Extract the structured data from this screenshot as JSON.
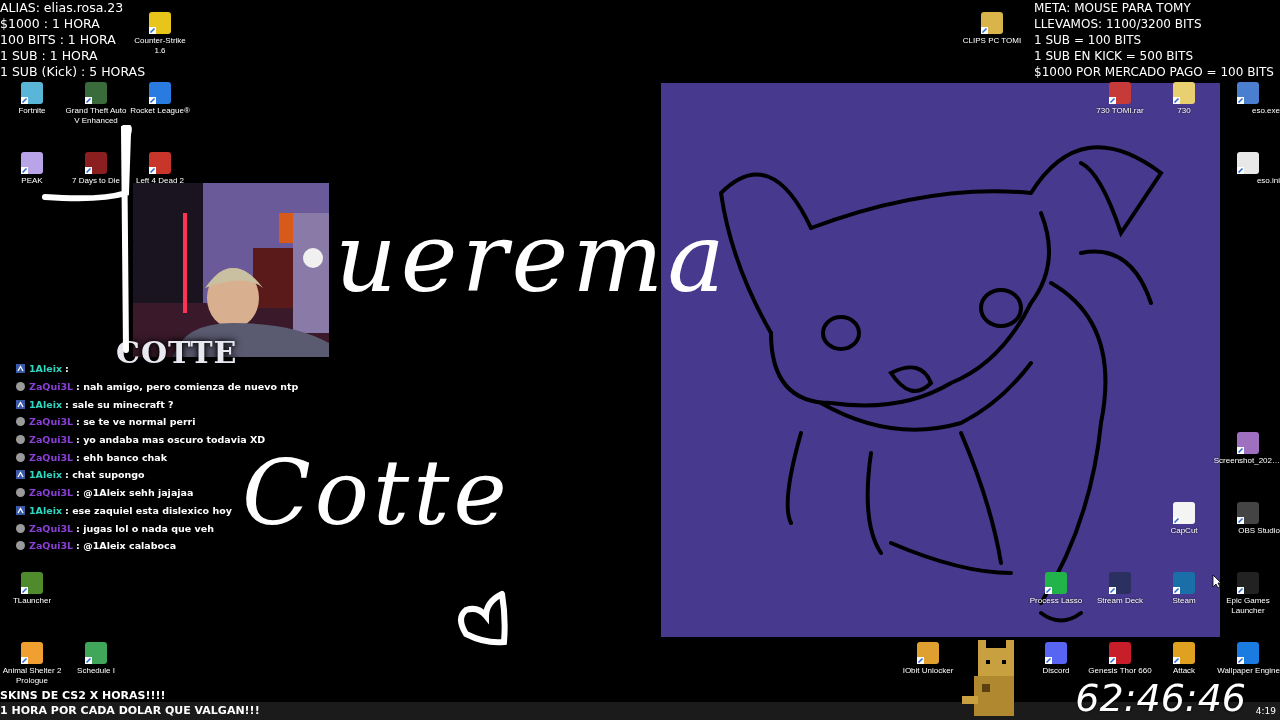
{
  "overlay_left": {
    "lines": [
      "ALIAS: elias.rosa.23",
      "$1000 : 1 HORA",
      "100 BITS : 1 HORA",
      "1 SUB : 1 HORA",
      "1 SUB (Kick) : 5 HORAS"
    ]
  },
  "overlay_right": {
    "lines": [
      "META: MOUSE PARA TOMY",
      "LLEVAMOS: 1100/3200 BITS",
      "1 SUB = 100 BITS",
      "1 SUB EN KICK = 500 BITS",
      "$1000 POR MERCADO PAGO = 100 BITS"
    ]
  },
  "desktop_icons": [
    {
      "label": "Counter-Strike 1.6"
    },
    {
      "label": "Fortnite"
    },
    {
      "label": "Grand Theft Auto V Enhanced"
    },
    {
      "label": "Rocket League®"
    },
    {
      "label": "PEAK"
    },
    {
      "label": "7 Days to Die"
    },
    {
      "label": "Left 4 Dead 2"
    },
    {
      "label": "TLauncher"
    },
    {
      "label": "Animal Shelter 2 Prologue"
    },
    {
      "label": "Schedule I"
    },
    {
      "label": "CLIPS PC TOMI"
    },
    {
      "label": "730 TOMI.rar"
    },
    {
      "label": "730"
    },
    {
      "label": "eso.exe"
    },
    {
      "label": "eso.ini"
    },
    {
      "label": "Screenshot_202…"
    },
    {
      "label": "CapCut"
    },
    {
      "label": "OBS Studio"
    },
    {
      "label": "Process Lasso"
    },
    {
      "label": "Stream Deck"
    },
    {
      "label": "Steam"
    },
    {
      "label": "Epic Games Launcher"
    },
    {
      "label": "IObit Unlocker"
    },
    {
      "label": "Discord"
    },
    {
      "label": "Genesis Thor 660"
    },
    {
      "label": "Attack"
    },
    {
      "label": "Wallpaper Engine"
    }
  ],
  "webcam": {
    "kind": "picture",
    "logo": "COTTE"
  },
  "chat": [
    {
      "kind": "chevron",
      "user": "1Aleix",
      "color": "#2fd6c0",
      "message": ":"
    },
    {
      "kind": "circle",
      "user": "ZaQui3L",
      "color": "#8a3fd6",
      "message": ": nah amigo, pero comienza de nuevo ntp"
    },
    {
      "kind": "chevron",
      "user": "1Aleix",
      "color": "#2fd6c0",
      "message": ": sale su minecraft ?"
    },
    {
      "kind": "circle",
      "user": "ZaQui3L",
      "color": "#8a3fd6",
      "message": ": se te ve normal perri"
    },
    {
      "kind": "circle",
      "user": "ZaQui3L",
      "color": "#8a3fd6",
      "message": ": yo andaba mas oscuro todavia XD"
    },
    {
      "kind": "circle",
      "user": "ZaQui3L",
      "color": "#8a3fd6",
      "message": ": ehh banco chak"
    },
    {
      "kind": "chevron",
      "user": "1Aleix",
      "color": "#2fd6c0",
      "message": ": chat supongo"
    },
    {
      "kind": "circle",
      "user": "ZaQui3L",
      "color": "#8a3fd6",
      "message": ": @1Aleix sehh jajajaa"
    },
    {
      "kind": "chevron",
      "user": "1Aleix",
      "color": "#2fd6c0",
      "message": ": ese zaquiel esta dislexico hoy"
    },
    {
      "kind": "circle",
      "user": "ZaQui3L",
      "color": "#8a3fd6",
      "message": ": jugas lol o nada que veh"
    },
    {
      "kind": "circle",
      "user": "ZaQui3L",
      "color": "#8a3fd6",
      "message": ": @1Aleix calaboca"
    }
  ],
  "handwriting": [
    "uerema",
    "Cotte"
  ],
  "bottom_banner": [
    "SKINS DE CS2 X HORAS!!!!",
    "1 HORA POR CADA DOLAR QUE VALGAN!!!"
  ],
  "timer": "62:46:46",
  "clock": "4:19"
}
